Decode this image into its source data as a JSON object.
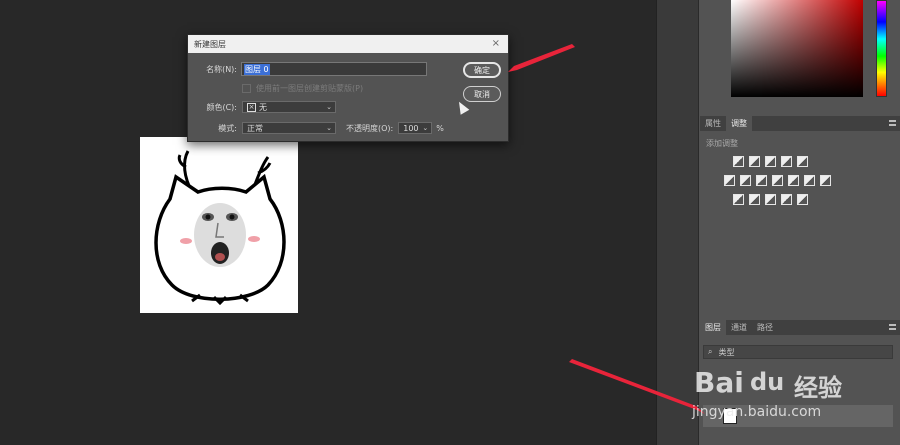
{
  "dialog": {
    "title": "新建图层",
    "close_glyph": "×",
    "name_label": "名称(N):",
    "name_value": "图层 0",
    "clip_checkbox_label": "使用前一图层创建剪贴蒙版(P)",
    "color_label": "颜色(C):",
    "color_value": "无",
    "color_x_glyph": "×",
    "mode_label": "模式:",
    "mode_value": "正常",
    "opacity_label": "不透明度(O):",
    "opacity_value": "100",
    "opacity_unit": "%",
    "ok_label": "确定",
    "cancel_label": "取消"
  },
  "panels": {
    "properties_tab": "属性",
    "adjustments_tab": "调整",
    "adjustments_title": "添加调整",
    "layers_tab": "图层",
    "channels_tab": "通道",
    "paths_tab": "路径",
    "layers_filter_label": "类型"
  },
  "watermark": {
    "brand": "Bai",
    "brand_paw": "du",
    "brand_cn": "经验",
    "url": "jingyan.baidu.com"
  },
  "colors": {
    "arrow": "#e8243a",
    "dialog_bg": "#535353",
    "workspace_bg": "#282828",
    "selection": "#3b6fd6"
  },
  "icons": {
    "chevron": "⌄",
    "cursor": "mouse-cursor-icon"
  }
}
